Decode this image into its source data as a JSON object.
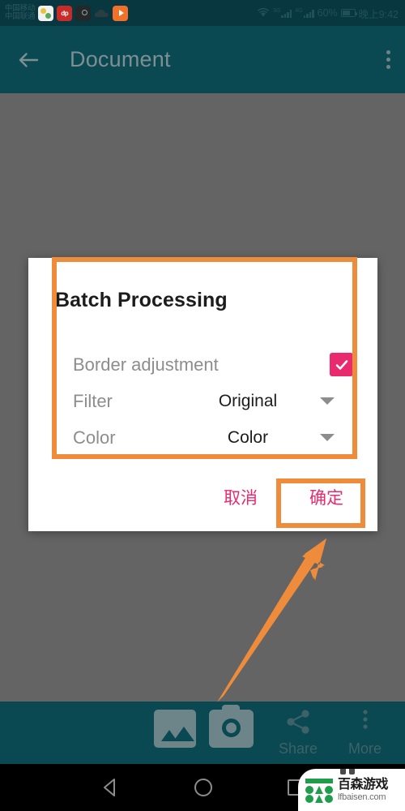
{
  "statusbar": {
    "carrier_line1": "中国移动",
    "carrier_line2": "中国联通",
    "app_icons": [
      "photos-icon",
      "dp-icon",
      "dark-app-icon",
      "cloud-icon",
      "play-icon"
    ],
    "dp_label": "dp",
    "sim1_network": "3G",
    "sim2_network": "4G",
    "battery_percent": "60%",
    "clock": "晚上9:42",
    "wifi_icon": "wifi-icon",
    "battery_icon": "battery-icon"
  },
  "appbar": {
    "back_icon": "back-arrow-icon",
    "title": "Document",
    "overflow_icon": "kebab-menu-icon"
  },
  "dialog": {
    "title": "Batch Processing",
    "rows": [
      {
        "label": "Border adjustment",
        "control": "checkbox",
        "checked": true
      },
      {
        "label": "Filter",
        "value": "Original",
        "control": "dropdown"
      },
      {
        "label": "Color",
        "value": "Color",
        "control": "dropdown"
      }
    ],
    "cancel_label": "取消",
    "confirm_label": "确定"
  },
  "annotations": {
    "highlight_color": "#ef8c3b",
    "arrow": "orange-pointer-arrow"
  },
  "bottombar": {
    "items": [
      {
        "name": "gallery",
        "icon": "gallery-icon",
        "label": ""
      },
      {
        "name": "camera",
        "icon": "camera-icon",
        "label": ""
      },
      {
        "name": "share",
        "icon": "share-icon",
        "label": "Share"
      },
      {
        "name": "more",
        "icon": "more-kebab-icon",
        "label": "More"
      }
    ]
  },
  "navbar": {
    "back": "nav-back-triangle-icon",
    "home": "nav-home-circle-icon",
    "recent": "nav-recents-square-icon"
  },
  "watermark": {
    "name_cn": "百森游戏",
    "url": "lfbaisen.com"
  },
  "colors": {
    "appbar": "#0a4852",
    "statusbar": "#093740",
    "scrim": "#646464",
    "accent_pink": "#ea2a6f",
    "highlight_orange": "#ef8c3b",
    "dialog_bg": "#ffffff"
  }
}
